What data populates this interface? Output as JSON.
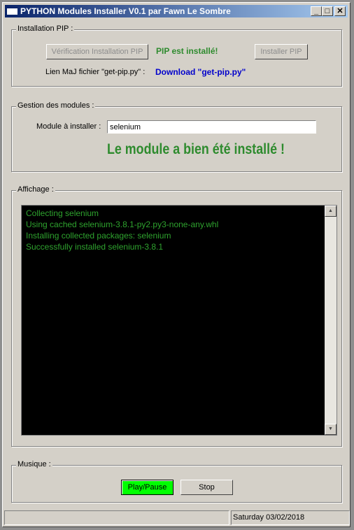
{
  "window": {
    "title": "PYTHON Modules Installer V0.1 par Fawn Le Sombre",
    "minimize": "_",
    "maximize": "□",
    "close": "✕"
  },
  "pip": {
    "legend": "Installation PIP :",
    "verify_button": "Vérification Installation PIP",
    "status": "PIP est installé!",
    "install_button": "Installer PIP",
    "link_label": "Lien MaJ fichier \"get-pip.py\" :",
    "link_text": "Download \"get-pip.py\""
  },
  "modules": {
    "legend": "Gestion des modules :",
    "input_label": "Module à installer :",
    "input_value": "selenium",
    "result": "Le module a bien été installé !"
  },
  "display": {
    "legend": "Affichage :",
    "lines": [
      "Collecting selenium",
      "Using cached selenium-3.8.1-py2.py3-none-any.whl",
      "Installing collected packages: selenium",
      "Successfully installed selenium-3.8.1"
    ]
  },
  "music": {
    "legend": "Musique :",
    "play_button": "Play/Pause",
    "stop_button": "Stop"
  },
  "statusbar": {
    "left": "",
    "date": "Saturday 03/02/2018"
  },
  "colors": {
    "success": "#2e8b2e",
    "link": "#0000cc",
    "play": "#00ff00"
  }
}
